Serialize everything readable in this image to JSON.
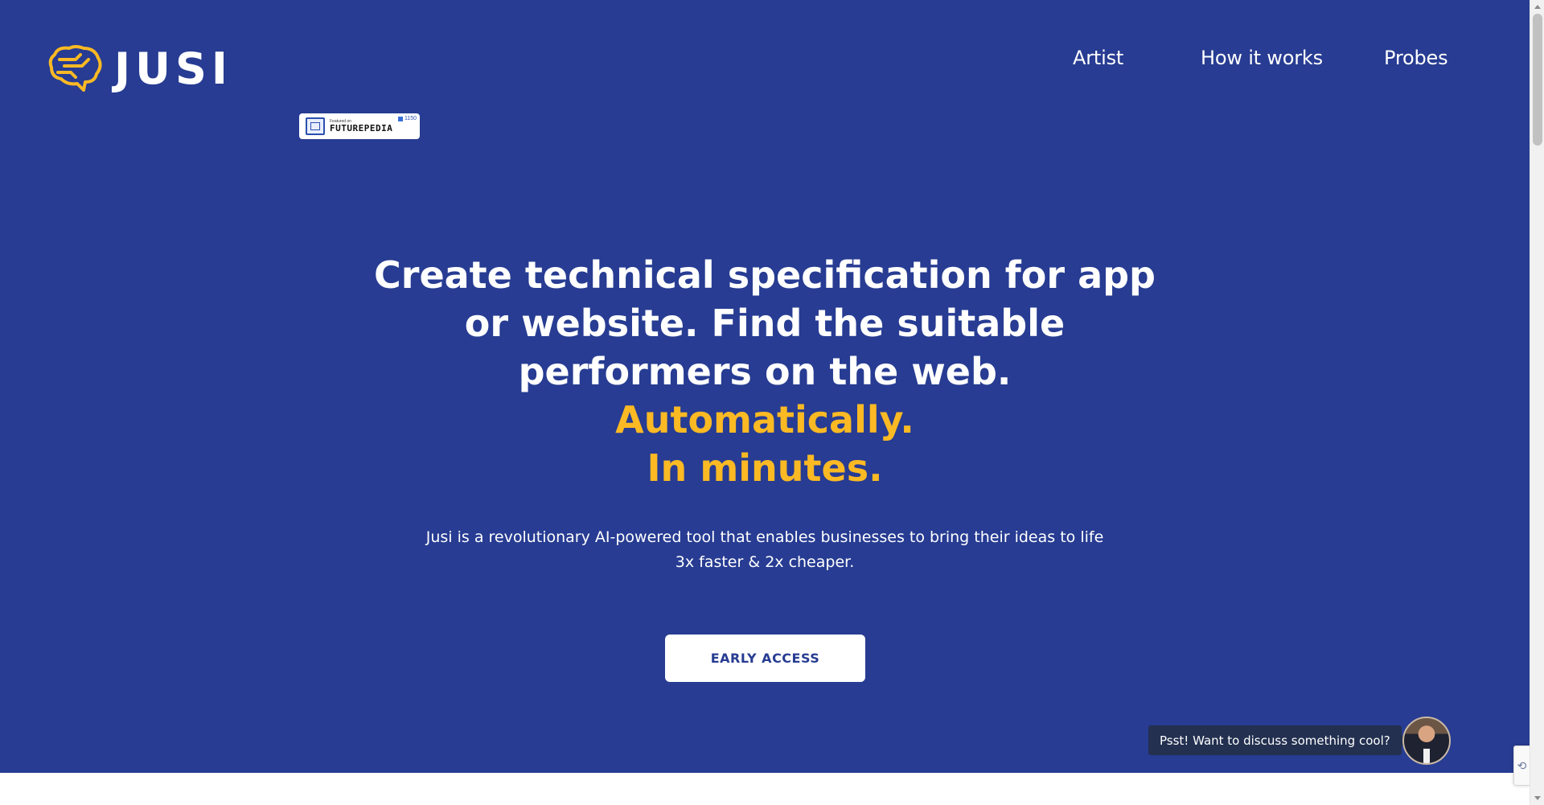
{
  "brand": {
    "name": "JUSI",
    "logo_icon": "brain-circuit-icon",
    "logo_color": "#fbb924"
  },
  "nav": {
    "items": [
      {
        "label": "Artist"
      },
      {
        "label": "How it works"
      },
      {
        "label": "Probes"
      }
    ]
  },
  "badge": {
    "small_text": "Featured on",
    "name": "FUTUREPEDIA",
    "count": "1150"
  },
  "hero": {
    "headline_lines": [
      "Create technical specification for app",
      "or website. Find the suitable",
      "performers on the web."
    ],
    "accent_lines": [
      "Automatically.",
      "In minutes."
    ],
    "subtitle_lines": [
      "Jusi is a revolutionary AI-powered tool that enables businesses to bring their ideas to life",
      "3x faster & 2x cheaper."
    ],
    "cta_label": "EARLY ACCESS"
  },
  "chat": {
    "message": "Psst! Want to discuss something cool?"
  },
  "colors": {
    "background": "#273c92",
    "accent": "#fbb924",
    "text": "#ffffff"
  }
}
